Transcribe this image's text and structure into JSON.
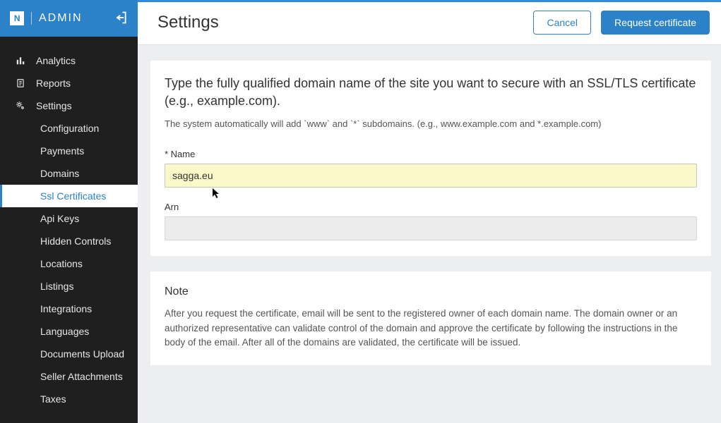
{
  "brand": {
    "logo_letter": "N",
    "text": "ADMIN"
  },
  "nav": {
    "items": [
      {
        "label": "Analytics",
        "icon": "bar-chart-icon"
      },
      {
        "label": "Reports",
        "icon": "document-icon"
      },
      {
        "label": "Settings",
        "icon": "gears-icon"
      }
    ],
    "settings_sub": [
      {
        "label": "Configuration"
      },
      {
        "label": "Payments"
      },
      {
        "label": "Domains"
      },
      {
        "label": "Ssl Certificates",
        "active": true
      },
      {
        "label": "Api Keys"
      },
      {
        "label": "Hidden Controls"
      },
      {
        "label": "Locations"
      },
      {
        "label": "Listings"
      },
      {
        "label": "Integrations"
      },
      {
        "label": "Languages"
      },
      {
        "label": "Documents Upload"
      },
      {
        "label": "Seller Attachments"
      },
      {
        "label": "Taxes"
      }
    ]
  },
  "topbar": {
    "title": "Settings",
    "cancel": "Cancel",
    "request": "Request certificate"
  },
  "form_card": {
    "heading": "Type the fully qualified domain name of the site you want to secure with an SSL/TLS certificate (e.g., example.com).",
    "sub": "The system automatically will add `www` and `*` subdomains. (e.g., www.example.com and *.example.com)",
    "name_label": "* Name",
    "name_value": "sagga.eu",
    "arn_label": "Arn",
    "arn_value": ""
  },
  "note_card": {
    "title": "Note",
    "body": "After you request the certificate, email will be sent to the registered owner of each domain name. The domain owner or an authorized representative can validate control of the domain and approve the certificate by following the instructions in the body of the email. After all of the domains are validated, the certificate will be issued."
  }
}
